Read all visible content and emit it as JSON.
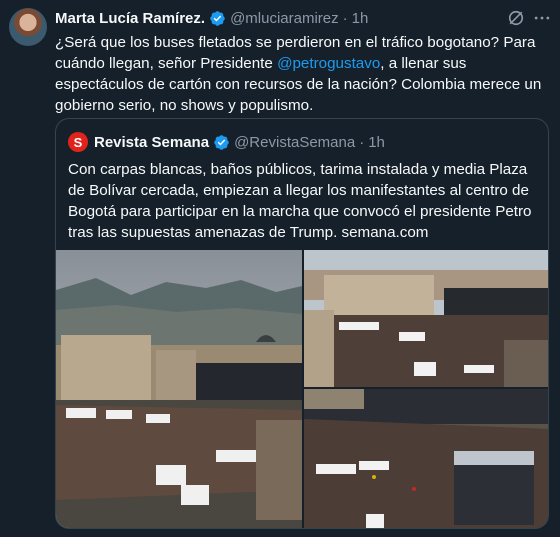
{
  "author": {
    "name": "Marta Lucía Ramírez.",
    "handle": "@mluciaramirez",
    "time": "1h"
  },
  "tweet": {
    "text_before": "¿Será que los buses fletados se perdieron en el tráfico bogotano? Para cuándo llegan, señor Presidente ",
    "mention": "@petrogustavo",
    "text_after": ", a llenar sus espectáculos de cartón con recursos de la nación? Colombia merece un gobierno serio, no shows y populismo."
  },
  "quote": {
    "logo_letter": "S",
    "name": "Revista Semana",
    "handle": "@RevistaSemana",
    "time": "1h",
    "text": "Con carpas blancas, baños públicos, tarima instalada y media Plaza de Bolívar cercada, empiezan a llegar los manifestantes al centro de Bogotá para participar en la marcha que convocó el presidente Petro tras las supuestas amenazas de Trump. semana.com"
  },
  "icons": {
    "verified": "verified-badge-icon",
    "grok": "grok-icon",
    "more": "more-options-icon"
  },
  "colors": {
    "background": "#15202b",
    "text": "#f7f9f9",
    "secondary": "#8b98a5",
    "accent": "#1d9bf0",
    "border": "#38444d",
    "semana_red": "#e0241b"
  },
  "separator": "·"
}
